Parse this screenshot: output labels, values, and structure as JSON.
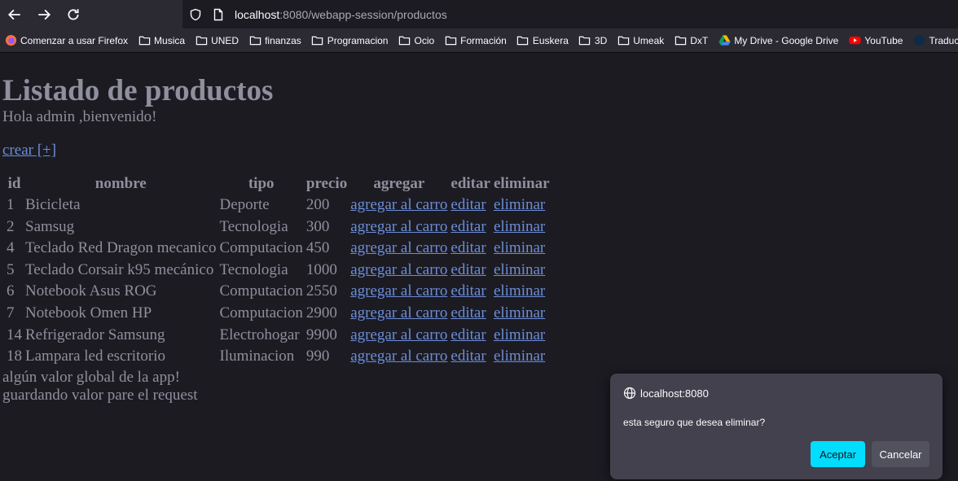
{
  "browser": {
    "url_host": "localhost",
    "url_rest": ":8080/webapp-session/productos",
    "bookmarks": [
      {
        "label": "Comenzar a usar Firefox",
        "icon": "firefox-icon"
      },
      {
        "label": "Musica",
        "icon": "folder-icon"
      },
      {
        "label": "UNED",
        "icon": "folder-icon"
      },
      {
        "label": "finanzas",
        "icon": "folder-icon"
      },
      {
        "label": "Programacion",
        "icon": "folder-icon"
      },
      {
        "label": "Ocio",
        "icon": "folder-icon"
      },
      {
        "label": "Formación",
        "icon": "folder-icon"
      },
      {
        "label": "Euskera",
        "icon": "folder-icon"
      },
      {
        "label": "3D",
        "icon": "folder-icon"
      },
      {
        "label": "Umeak",
        "icon": "folder-icon"
      },
      {
        "label": "DxT",
        "icon": "folder-icon"
      },
      {
        "label": "My Drive - Google Drive",
        "icon": "google-drive-icon"
      },
      {
        "label": "YouTube",
        "icon": "youtube-icon"
      },
      {
        "label": "Traductor d",
        "icon": "translator-icon"
      }
    ]
  },
  "page": {
    "title": "Listado de productos",
    "greeting": "Hola admin ,bienvenido!",
    "create_link": "crear [+]",
    "table": {
      "headers": [
        "id",
        "nombre",
        "tipo",
        "precio",
        "agregar",
        "editar",
        "eliminar"
      ],
      "rows": [
        {
          "id": "1",
          "nombre": "Bicicleta",
          "tipo": "Deporte",
          "precio": "200"
        },
        {
          "id": "2",
          "nombre": "Samsug",
          "tipo": "Tecnologia",
          "precio": "300"
        },
        {
          "id": "4",
          "nombre": "Teclado Red Dragon mecanico",
          "tipo": "Computacion",
          "precio": "450"
        },
        {
          "id": "5",
          "nombre": "Teclado Corsair k95 mecánico",
          "tipo": "Tecnologia",
          "precio": "1000"
        },
        {
          "id": "6",
          "nombre": "Notebook Asus ROG",
          "tipo": "Computacion",
          "precio": "2550"
        },
        {
          "id": "7",
          "nombre": "Notebook Omen HP",
          "tipo": "Computacion",
          "precio": "2900"
        },
        {
          "id": "14",
          "nombre": "Refrigerador Samsung",
          "tipo": "Electrohogar",
          "precio": "9900"
        },
        {
          "id": "18",
          "nombre": "Lampara led escritorio",
          "tipo": "Iluminacion",
          "precio": "990"
        }
      ],
      "link_add": "agregar al carro",
      "link_edit": "editar",
      "link_delete": "eliminar"
    },
    "footer_global": "algún valor global de la app!",
    "footer_request": "guardando valor pare el request"
  },
  "dialog": {
    "origin": "localhost:8080",
    "message": "esta seguro que desea eliminar?",
    "ok_label": "Aceptar",
    "cancel_label": "Cancelar"
  },
  "colors": {
    "page_bg": "#1c1b22",
    "text": "#8f8f9d",
    "link": "#6c8dd8",
    "accent_button": "#00ddff",
    "dialog_bg": "#42414d"
  }
}
